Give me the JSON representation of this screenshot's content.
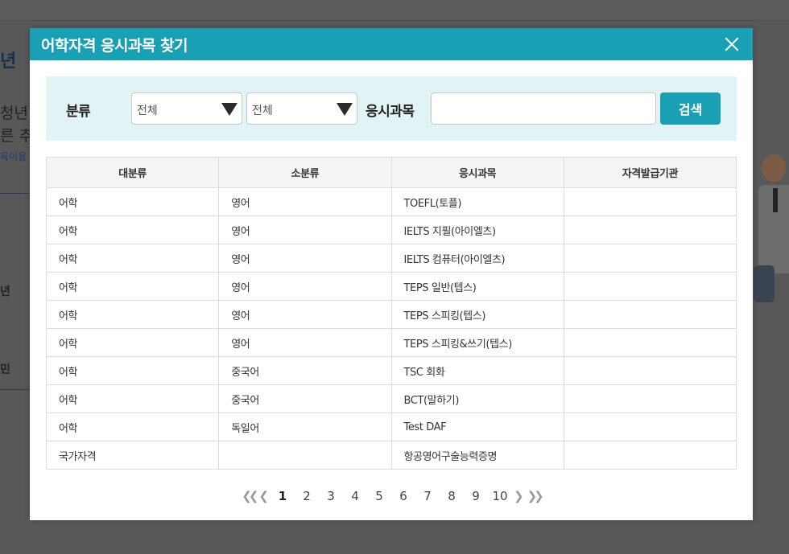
{
  "background": {
    "fragments": [
      "년",
      "청년",
      "른 추",
      "육이용",
      "년",
      "민"
    ]
  },
  "modal": {
    "title": "어학자격 응시과목 찾기",
    "close_icon": "close-icon"
  },
  "search": {
    "category_label": "분류",
    "major_select_value": "전체",
    "minor_select_value": "전체",
    "subject_label": "응시과목",
    "subject_input_value": "",
    "search_button_label": "검색"
  },
  "table": {
    "headers": [
      "대분류",
      "소분류",
      "응시과목",
      "자격발급기관"
    ],
    "rows": [
      [
        "어학",
        "영어",
        "TOEFL(토플)",
        ""
      ],
      [
        "어학",
        "영어",
        "IELTS 지필(아이엘츠)",
        ""
      ],
      [
        "어학",
        "영어",
        "IELTS 컴퓨터(아이엘츠)",
        ""
      ],
      [
        "어학",
        "영어",
        "TEPS 일반(텝스)",
        ""
      ],
      [
        "어학",
        "영어",
        "TEPS 스피킹(텝스)",
        ""
      ],
      [
        "어학",
        "영어",
        "TEPS 스피킹&쓰기(텝스)",
        ""
      ],
      [
        "어학",
        "중국어",
        "TSC 회화",
        ""
      ],
      [
        "어학",
        "중국어",
        "BCT(말하기)",
        ""
      ],
      [
        "어학",
        "독일어",
        "Test DAF",
        ""
      ],
      [
        "국가자격",
        "",
        "항공영어구술능력증명",
        ""
      ]
    ]
  },
  "pagination": {
    "first": "«",
    "prev": "‹",
    "pages": [
      "1",
      "2",
      "3",
      "4",
      "5",
      "6",
      "7",
      "8",
      "9",
      "10"
    ],
    "current": "1",
    "next": "›",
    "last": "»"
  },
  "colors": {
    "accent": "#1aa0b5",
    "search_bg": "#e2f3f6",
    "header_bg": "#f5f5f5"
  }
}
